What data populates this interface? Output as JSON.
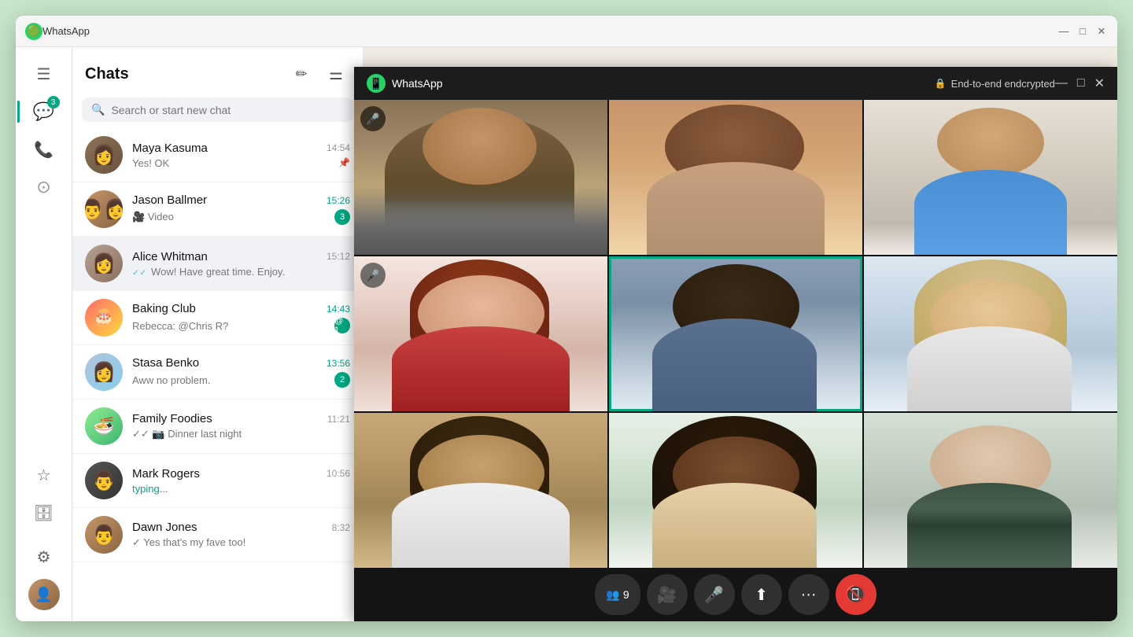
{
  "window": {
    "title": "WhatsApp",
    "min_label": "−",
    "max_label": "□",
    "close_label": "✕"
  },
  "sidebar": {
    "badge": "3",
    "icons": [
      {
        "name": "menu",
        "symbol": "☰",
        "active": false
      },
      {
        "name": "chats",
        "symbol": "💬",
        "active": true,
        "badge": "3"
      },
      {
        "name": "calls",
        "symbol": "📞",
        "active": false
      },
      {
        "name": "status",
        "symbol": "◎",
        "active": false
      },
      {
        "name": "starred",
        "symbol": "★",
        "active": false
      },
      {
        "name": "archived",
        "symbol": "🗄",
        "active": false
      }
    ]
  },
  "chat_list": {
    "title": "Chats",
    "new_chat_icon": "✏",
    "filter_icon": "≡",
    "search_placeholder": "Search or start new chat",
    "chats": [
      {
        "id": "maya",
        "name": "Maya Kasuma",
        "message": "Yes! OK",
        "time": "14:54",
        "unread": false,
        "pinned": true,
        "avatar_bg": "maya"
      },
      {
        "id": "jason",
        "name": "Jason Ballmer",
        "message": "🎥 Video",
        "time": "15:26",
        "unread": true,
        "badge": "3",
        "avatar_bg": "jason"
      },
      {
        "id": "alice",
        "name": "Alice Whitman",
        "message": "✓✓ Wow! Have great time. Enjoy.",
        "time": "15:12",
        "unread": false,
        "active": true,
        "avatar_bg": "alice"
      },
      {
        "id": "baking",
        "name": "Baking Club",
        "message": "Rebecca: @Chris R?",
        "time": "14:43",
        "unread": true,
        "badge": "1",
        "mention": true,
        "avatar_bg": "baking"
      },
      {
        "id": "stasa",
        "name": "Stasa Benko",
        "message": "Aww no problem.",
        "time": "13:56",
        "unread": true,
        "badge": "2",
        "avatar_bg": "stasa"
      },
      {
        "id": "family",
        "name": "Family Foodies",
        "message": "✓✓ 📷 Dinner last night",
        "time": "11:21",
        "unread": false,
        "avatar_bg": "family"
      },
      {
        "id": "mark",
        "name": "Mark Rogers",
        "message": "typing...",
        "time": "10:56",
        "typing": true,
        "unread": false,
        "avatar_bg": "mark"
      },
      {
        "id": "dawn",
        "name": "Dawn Jones",
        "message": "✓ Yes that's my fave too!",
        "time": "8:32",
        "unread": false,
        "avatar_bg": "dawn"
      }
    ]
  },
  "video_call": {
    "app_name": "WhatsApp",
    "encryption_label": "End-to-end endcrypted",
    "participants_count": "9",
    "controls": {
      "participants_label": "9",
      "video_label": "Video",
      "mic_label": "Mic",
      "share_label": "Share",
      "more_label": "More",
      "end_label": "End call"
    }
  }
}
